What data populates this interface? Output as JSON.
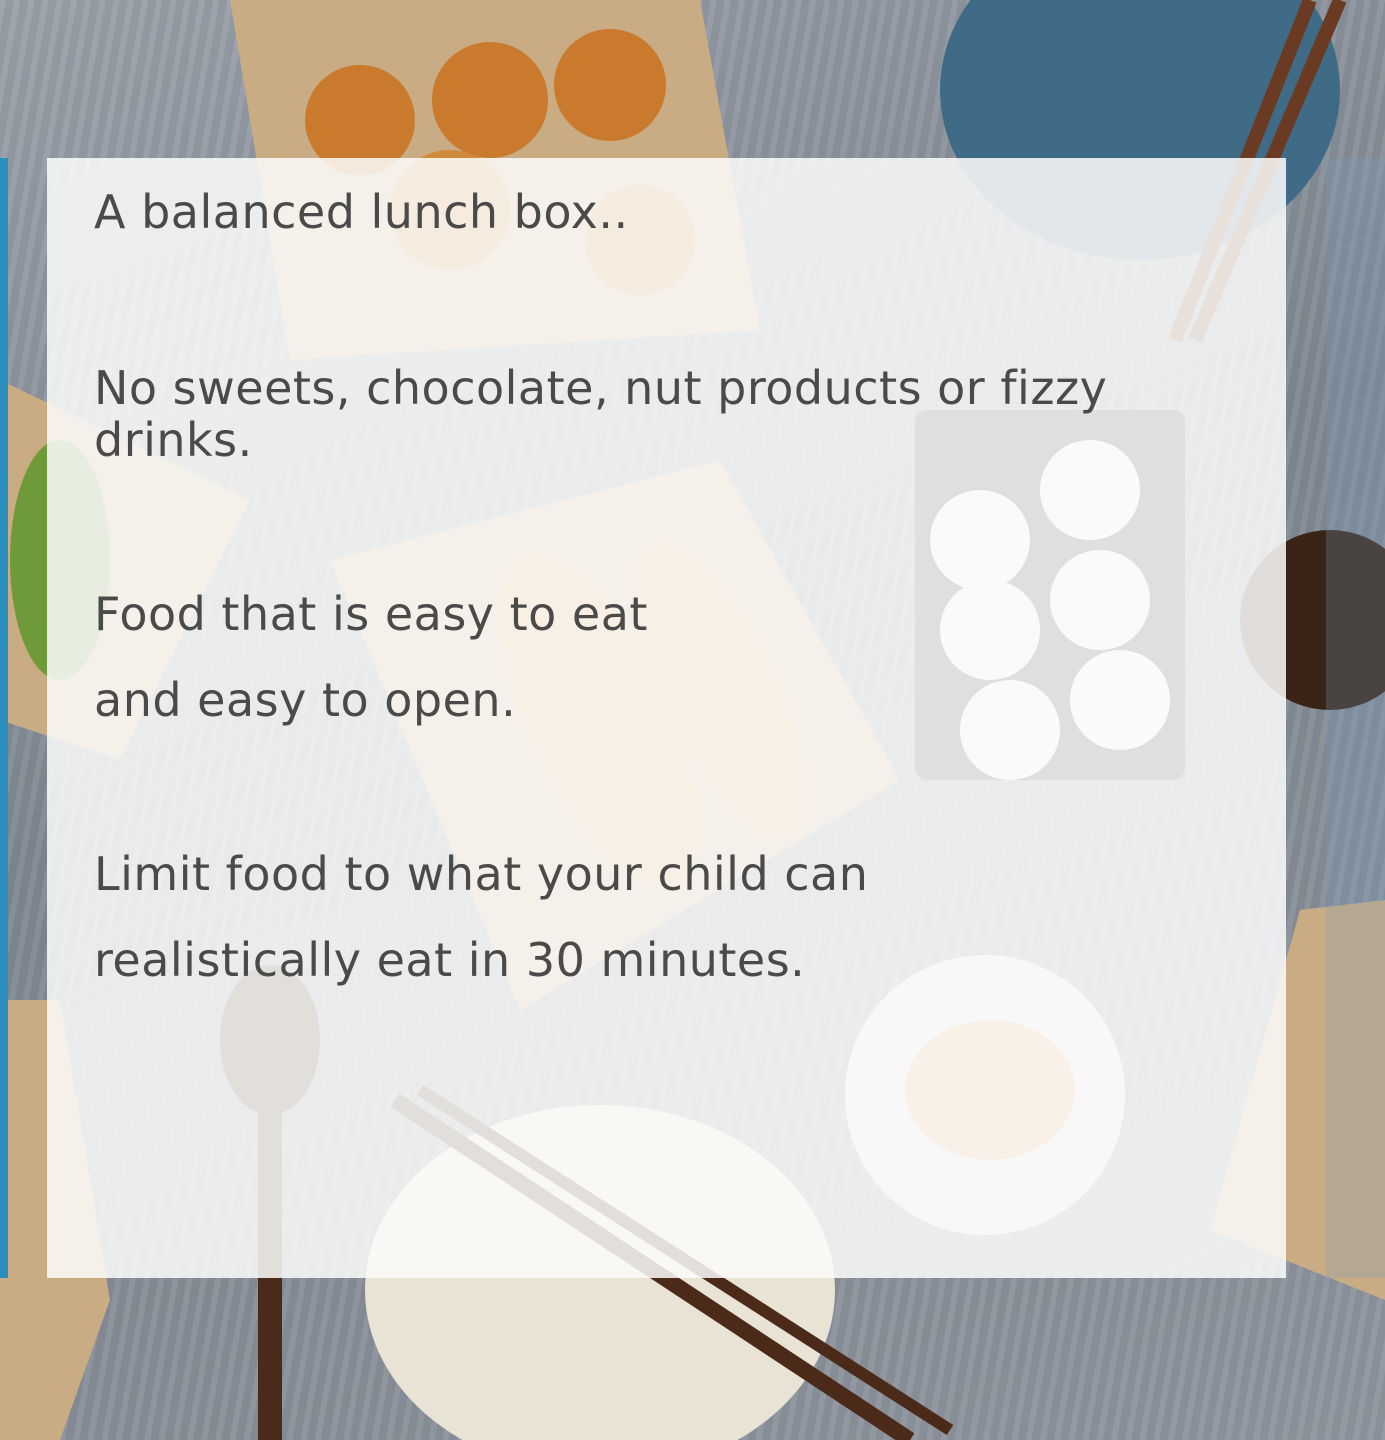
{
  "slide": {
    "title": "A balanced lunch box..",
    "rules": [
      {
        "lines": [
          "No sweets, chocolate, nut products or fizzy",
          "drinks."
        ]
      },
      {
        "lines": [
          "Food that is easy to eat",
          "and easy to open."
        ]
      },
      {
        "lines": [
          "Limit food to what your child can",
          "realistically eat in 30 minutes."
        ]
      }
    ]
  },
  "background": {
    "description_icon": "food-photo-background"
  },
  "colors": {
    "text": "#4a4a4a",
    "accent_bar": "#2a8fbd",
    "card": "#fcfbfa"
  }
}
